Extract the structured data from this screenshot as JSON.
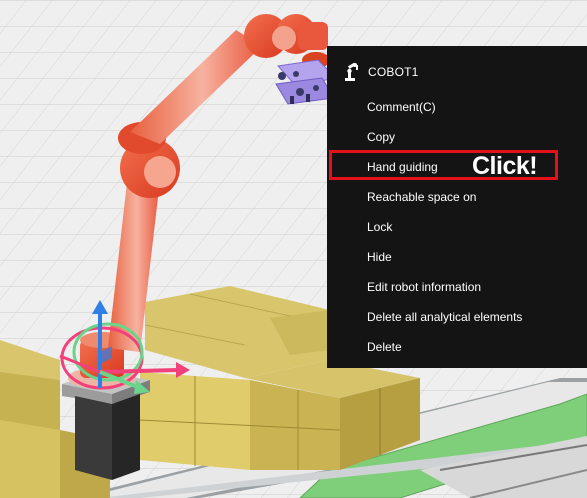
{
  "context_menu": {
    "header_icon": "robot-arm-icon",
    "title": "COBOT1",
    "items": [
      {
        "label": "Comment(C)"
      },
      {
        "label": "Copy"
      },
      {
        "label": "Hand guiding"
      },
      {
        "label": "Reachable space on"
      },
      {
        "label": "Lock"
      },
      {
        "label": "Hide"
      },
      {
        "label": "Edit robot information"
      },
      {
        "label": "Delete all analytical elements"
      },
      {
        "label": "Delete"
      }
    ],
    "highlighted_item": "Hand guiding",
    "highlight_color": "#e5111a"
  },
  "annotation": {
    "click_label": "Click!"
  },
  "scene": {
    "robot_color": "#e9573c",
    "box_color": "#d9c66c",
    "conveyor_belt_color": "#7fcf7a",
    "gripper_color": "#9b88e0",
    "gizmo_colors": {
      "x": "#f2407a",
      "y": "#6ad58a",
      "z": "#2f7fe6"
    }
  }
}
